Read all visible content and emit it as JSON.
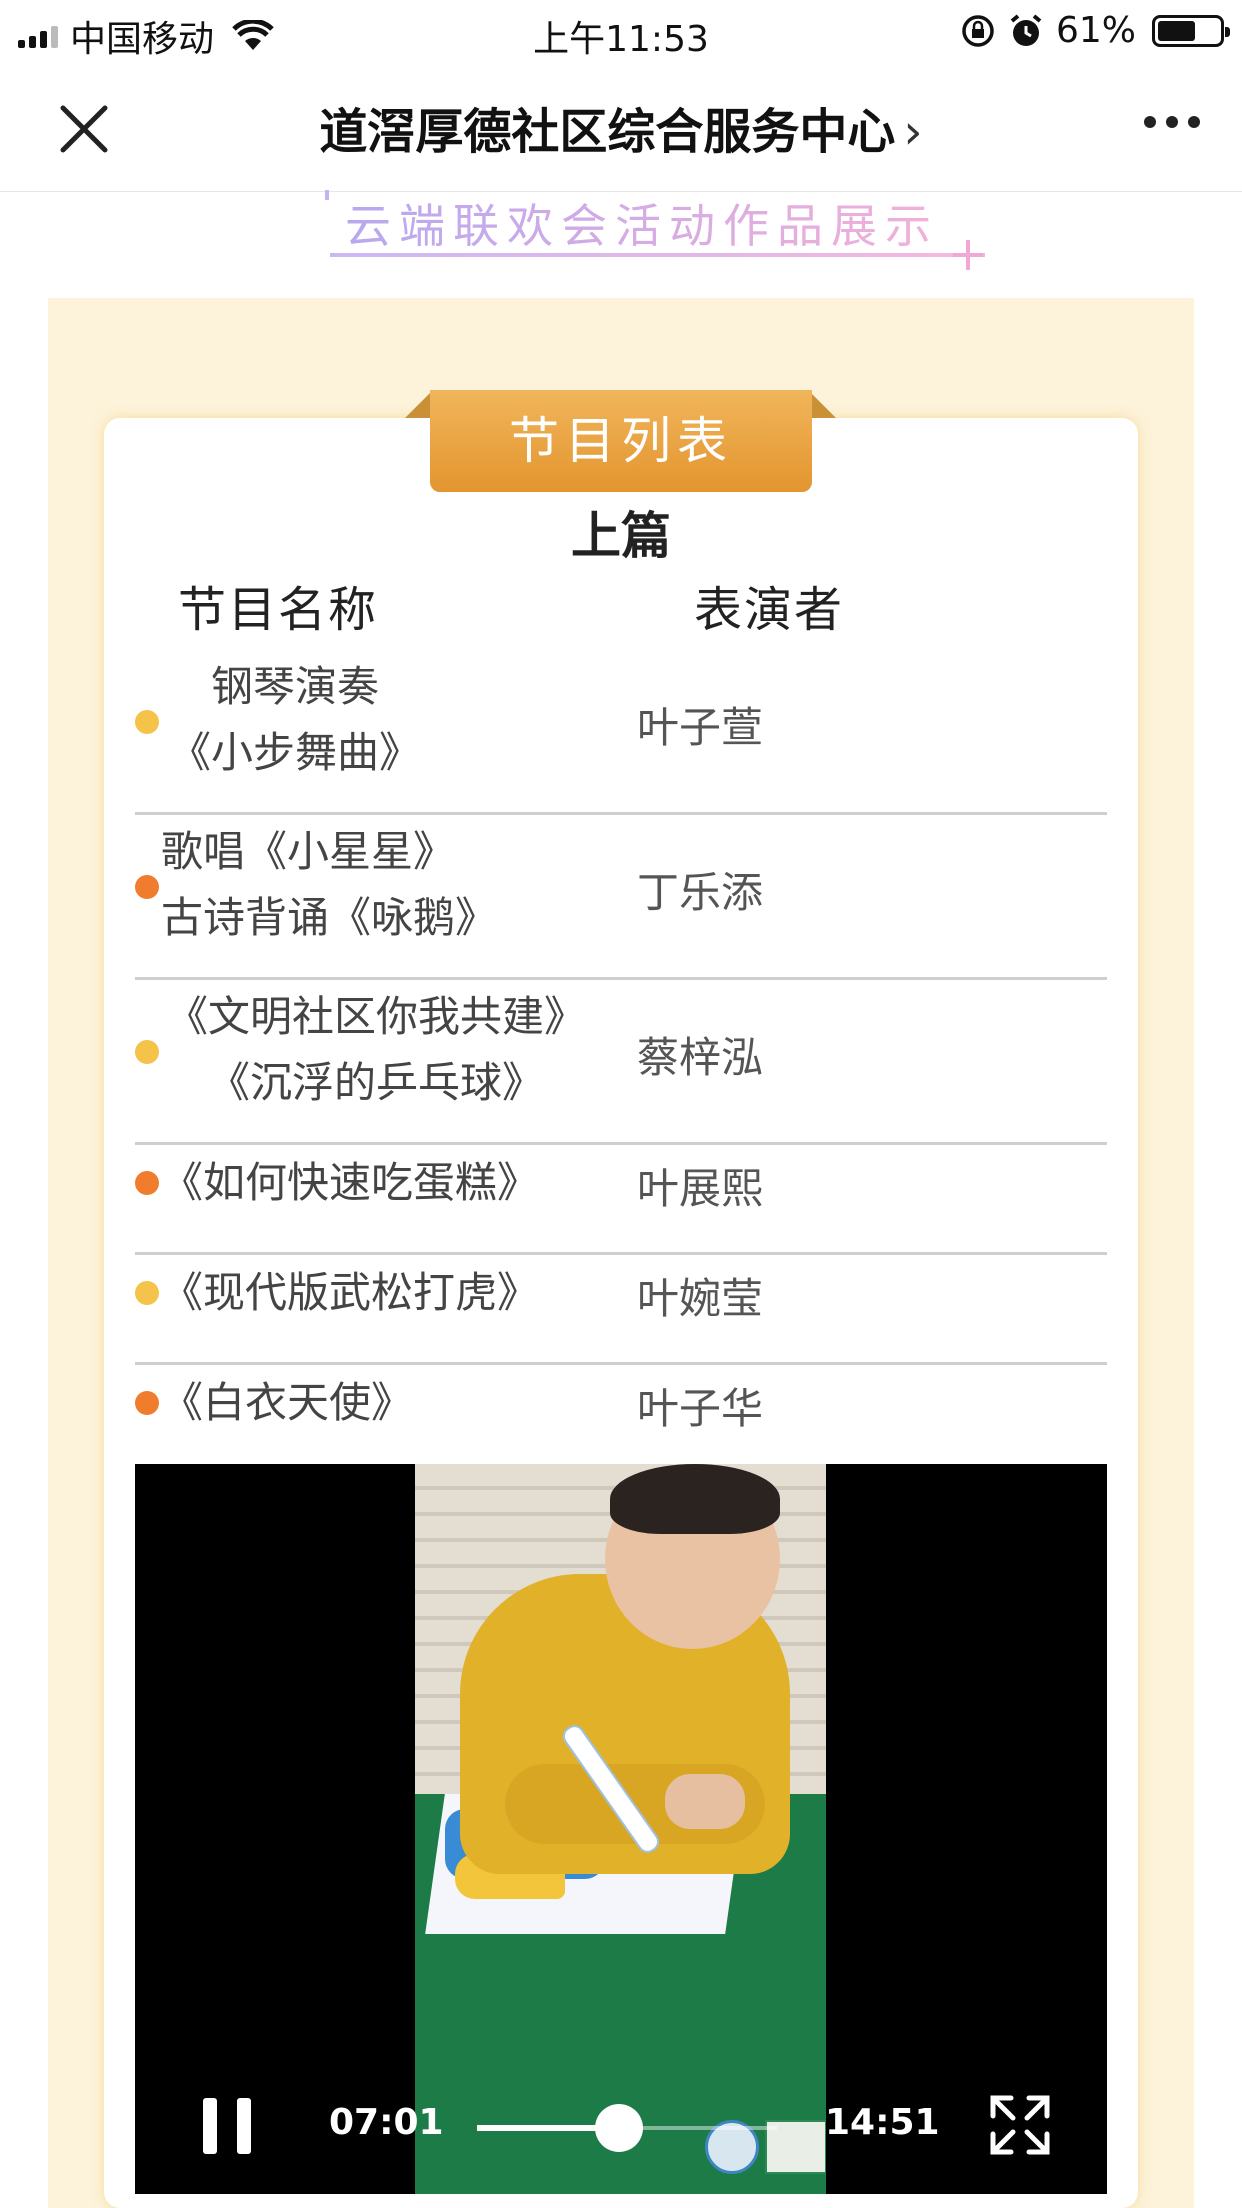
{
  "status_bar": {
    "carrier": "中国移动",
    "time": "上午11:53",
    "battery_percent": "61%",
    "battery_level": 0.61,
    "icons": [
      "signal-icon",
      "wifi-icon",
      "rotation-lock-icon",
      "alarm-icon",
      "battery-icon"
    ]
  },
  "nav": {
    "title": "道滘厚德社区综合服务中心",
    "chevron": "›",
    "icons": [
      "close-icon",
      "more-icon"
    ]
  },
  "banner": {
    "title": "云端联欢会活动作品展示"
  },
  "program_list": {
    "ribbon_label": "节目列表",
    "section_title": "上篇",
    "column_headers": {
      "name": "节目名称",
      "performer": "表演者"
    },
    "rows": [
      {
        "lines": [
          "钢琴演奏",
          "《小步舞曲》"
        ],
        "performer": "叶子萱",
        "dot_color": "#f5c24a"
      },
      {
        "lines": [
          "歌唱《小星星》",
          "古诗背诵《咏鹅》"
        ],
        "performer": "丁乐添",
        "dot_color": "#f07d2e"
      },
      {
        "lines": [
          "《文明社区你我共建》",
          "《沉浮的乒乓球》"
        ],
        "performer": "蔡梓泓",
        "dot_color": "#f5c24a"
      },
      {
        "lines": [
          "《如何快速吃蛋糕》"
        ],
        "performer": "叶展熙",
        "dot_color": "#f07d2e"
      },
      {
        "lines": [
          "《现代版武松打虎》"
        ],
        "performer": "叶婉莹",
        "dot_color": "#f5c24a"
      },
      {
        "lines": [
          "《白衣天使》"
        ],
        "performer": "叶子华",
        "dot_color": "#f07d2e"
      }
    ]
  },
  "video": {
    "current_time": "07:01",
    "total_time": "14:51",
    "progress": 0.4724,
    "state": "playing",
    "icons": [
      "pause-icon",
      "fullscreen-icon"
    ]
  },
  "colors": {
    "ribbon": "#e8a03f",
    "panel_background": "#fdf3da",
    "dot_yellow": "#f5c24a",
    "dot_orange": "#f07d2e"
  }
}
